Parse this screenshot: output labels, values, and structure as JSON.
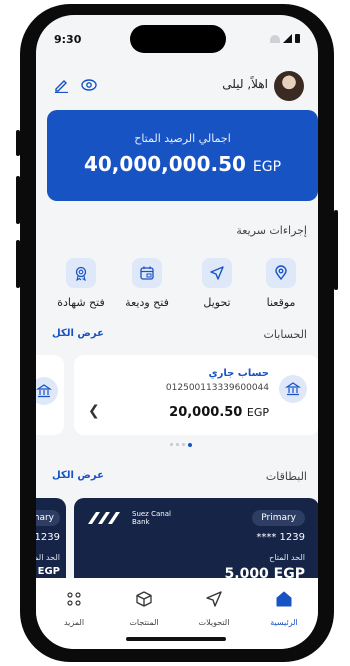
{
  "status": {
    "time": "9:30"
  },
  "header": {
    "greeting": "اهلاً, ليلى"
  },
  "balance": {
    "label": "اجمالي الرصيد المتاح",
    "amount": "40,000,000.50",
    "currency": "EGP"
  },
  "quick_actions": {
    "title": "إجراءات سريعة",
    "items": [
      {
        "label": "موقعنا",
        "icon": "location-icon"
      },
      {
        "label": "تحويل",
        "icon": "send-icon"
      },
      {
        "label": "فتح وديعة",
        "icon": "deposit-icon"
      },
      {
        "label": "فتح شهادة",
        "icon": "certificate-icon"
      }
    ]
  },
  "accounts": {
    "title": "الحسابات",
    "view_all": "عرض الكل",
    "card": {
      "name": "حساب جاري",
      "number": "012500113339600044",
      "balance": "20,000.50",
      "currency": "EGP"
    },
    "page_dots": 4,
    "active_dot": 3
  },
  "cards": {
    "title": "البطاقات",
    "view_all": "عرض الكل",
    "card": {
      "bank_name_line1": "Suez Canal",
      "bank_name_line2": "Bank",
      "badge": "Primary",
      "number": "**** 1239",
      "limit_label": "الحد المتاح",
      "limit": "5,000 EGP"
    },
    "peek": {
      "badge": "Primary",
      "number": "1239",
      "limit_label": "الحد المتاح",
      "limit": "EGP"
    }
  },
  "tabbar": {
    "items": [
      {
        "label": "الرئيسية",
        "icon": "home-icon",
        "active": true
      },
      {
        "label": "التحويلات",
        "icon": "send-icon",
        "active": false
      },
      {
        "label": "المنتجات",
        "icon": "box-icon",
        "active": false
      },
      {
        "label": "المزيد",
        "icon": "more-icon",
        "active": false
      }
    ]
  },
  "colors": {
    "primary": "#1853c4",
    "card_dark": "#152447",
    "background": "#f4f5f7"
  }
}
